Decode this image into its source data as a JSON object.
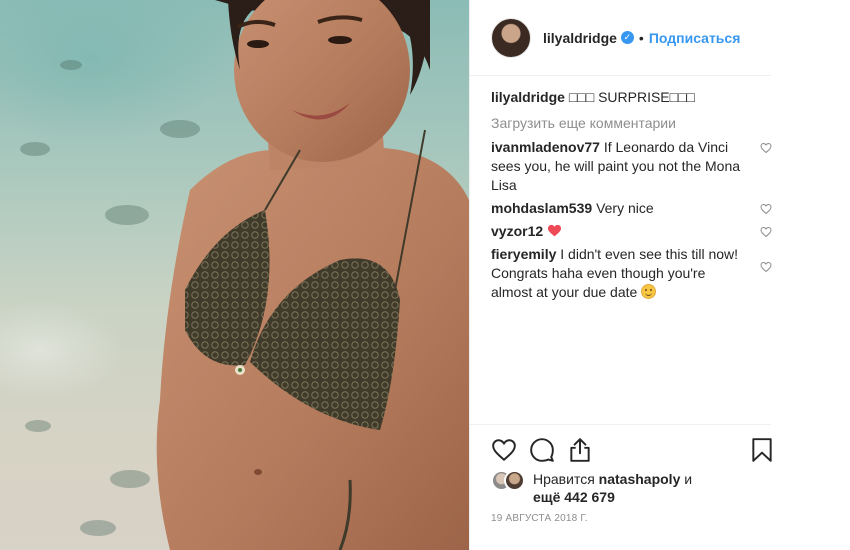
{
  "post": {
    "image_alt": "",
    "author": {
      "username": "lilyaldridge",
      "verified_glyph": "✓",
      "separator": "•",
      "follow_label": "Подписаться"
    },
    "caption": {
      "username": "lilyaldridge",
      "text": "□□□ SURPRISE□□□"
    },
    "load_more_label": "Загрузить еще комментарии",
    "comments": [
      {
        "username": "ivanmladenov77",
        "text": "If Leonardo da Vinci sees you, he will paint you not the Mona Lisa"
      },
      {
        "username": "mohdaslam539",
        "text": "Very nice"
      },
      {
        "username": "vyzor12",
        "text": "",
        "emoji": "heart-red-emoji"
      },
      {
        "username": "fieryemily",
        "text": "I didn't even see this till now! Congrats haha even though you're almost at your due date",
        "emoji": "smiling-face-emoji"
      }
    ],
    "likes": {
      "prefix": "Нравится",
      "liker": "natashapoly",
      "conjunction": "и",
      "more_label": "ещё 442 679"
    },
    "date": "19 АВГУСТА 2018 Г."
  },
  "icons": {
    "like": "heart-outline-icon",
    "comment": "comment-bubble-icon",
    "share": "share-upload-icon",
    "save": "bookmark-icon",
    "comment_like": "heart-small-icon"
  },
  "colors": {
    "accent": "#3897f0",
    "text": "#262626",
    "muted": "#8e8e8e",
    "border": "#efefef",
    "heart_red": "#ed4956"
  }
}
